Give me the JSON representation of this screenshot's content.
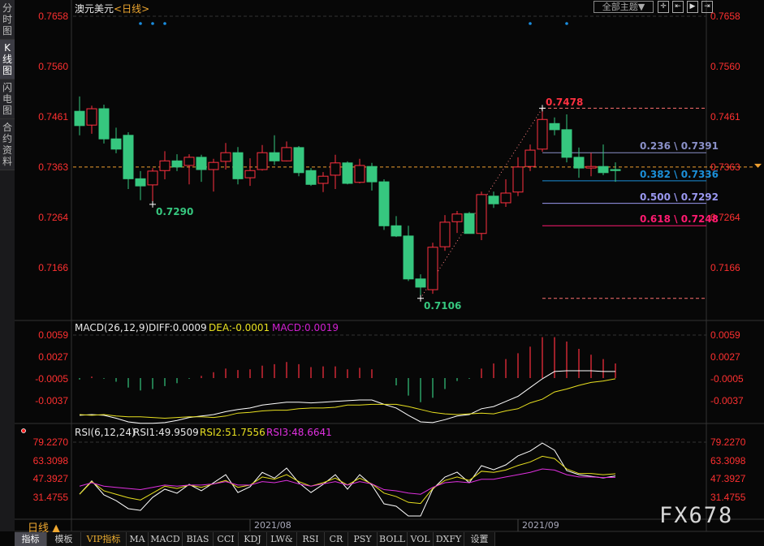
{
  "sidebar": {
    "tabs": [
      {
        "label": "分时图",
        "active": false
      },
      {
        "label": "K线图",
        "active": true
      },
      {
        "label": "闪电图",
        "active": false
      },
      {
        "label": "合约资料",
        "active": false
      }
    ]
  },
  "header": {
    "symbol": "澳元美元",
    "period": "<日线>",
    "themes_button": "全部主题▼",
    "icons": [
      "crosshair-icon",
      "zoom-left-icon",
      "play-forward-icon",
      "move-right-icon"
    ]
  },
  "colors": {
    "up": "#ff3040",
    "down": "#36c77f",
    "axis": "#ff3030",
    "diff": "#ffffff",
    "dea": "#e8e020",
    "macd": "#d020d0",
    "rsi1": "#ffffff",
    "rsi2": "#e8e020",
    "rsi3": "#e030e0",
    "current": "#f0a030"
  },
  "chart_data": [
    {
      "type": "candlestick",
      "title": "澳元美元 日线",
      "y_ticks": [
        "0.7658",
        "0.7560",
        "0.7461",
        "0.7363",
        "0.7264",
        "0.7166"
      ],
      "ylim": [
        0.709,
        0.7658
      ],
      "current_price": "0.7363",
      "x_labels": [
        "2021/08",
        "2021/09"
      ],
      "x_label_index": [
        16,
        38
      ],
      "ohlc": [
        [
          0.7472,
          0.7501,
          0.7425,
          0.7444
        ],
        [
          0.7445,
          0.7483,
          0.7428,
          0.7477
        ],
        [
          0.7477,
          0.7485,
          0.7409,
          0.7418
        ],
        [
          0.7418,
          0.744,
          0.739,
          0.7398
        ],
        [
          0.7425,
          0.7431,
          0.732,
          0.734
        ],
        [
          0.734,
          0.7355,
          0.7298,
          0.7326
        ],
        [
          0.7328,
          0.7361,
          0.729,
          0.7355
        ],
        [
          0.7356,
          0.7394,
          0.7339,
          0.7375
        ],
        [
          0.7375,
          0.7388,
          0.7355,
          0.7363
        ],
        [
          0.7366,
          0.7388,
          0.7329,
          0.7382
        ],
        [
          0.7382,
          0.7387,
          0.7334,
          0.7358
        ],
        [
          0.7358,
          0.7379,
          0.7315,
          0.7372
        ],
        [
          0.7374,
          0.741,
          0.7358,
          0.7391
        ],
        [
          0.7391,
          0.7402,
          0.7329,
          0.734
        ],
        [
          0.7342,
          0.738,
          0.7326,
          0.7356
        ],
        [
          0.7358,
          0.7406,
          0.7356,
          0.7391
        ],
        [
          0.7391,
          0.7425,
          0.7367,
          0.7375
        ],
        [
          0.7375,
          0.7413,
          0.7374,
          0.7401
        ],
        [
          0.7401,
          0.7404,
          0.7345,
          0.7352
        ],
        [
          0.7356,
          0.7361,
          0.7326,
          0.7329
        ],
        [
          0.7331,
          0.7353,
          0.7314,
          0.7345
        ],
        [
          0.7347,
          0.7387,
          0.732,
          0.7371
        ],
        [
          0.7371,
          0.7374,
          0.7329,
          0.7331
        ],
        [
          0.7333,
          0.7379,
          0.7331,
          0.7366
        ],
        [
          0.7364,
          0.7371,
          0.7317,
          0.7334
        ],
        [
          0.7334,
          0.7339,
          0.724,
          0.7248
        ],
        [
          0.7248,
          0.7267,
          0.7226,
          0.7228
        ],
        [
          0.7228,
          0.7248,
          0.714,
          0.7144
        ],
        [
          0.7144,
          0.7153,
          0.7106,
          0.7128
        ],
        [
          0.7123,
          0.7215,
          0.7115,
          0.7206
        ],
        [
          0.7207,
          0.7269,
          0.7199,
          0.7255
        ],
        [
          0.7256,
          0.7277,
          0.7234,
          0.7271
        ],
        [
          0.7272,
          0.7275,
          0.7233,
          0.7233
        ],
        [
          0.7233,
          0.7315,
          0.722,
          0.7309
        ],
        [
          0.7306,
          0.7315,
          0.7283,
          0.7291
        ],
        [
          0.7293,
          0.7339,
          0.7285,
          0.7312
        ],
        [
          0.7314,
          0.7382,
          0.7306,
          0.7363
        ],
        [
          0.7364,
          0.7407,
          0.7355,
          0.7396
        ],
        [
          0.7398,
          0.7478,
          0.7393,
          0.7456
        ],
        [
          0.7448,
          0.746,
          0.7425,
          0.7436
        ],
        [
          0.7436,
          0.7466,
          0.7372,
          0.7382
        ],
        [
          0.7382,
          0.7401,
          0.7342,
          0.7361
        ],
        [
          0.7361,
          0.7391,
          0.7345,
          0.7364
        ],
        [
          0.7364,
          0.7407,
          0.7347,
          0.7352
        ],
        [
          0.7358,
          0.7372,
          0.7334,
          0.7356
        ]
      ],
      "annotations": {
        "low": {
          "index": 28,
          "value": "0.7106"
        },
        "high": {
          "index": 38,
          "value": "0.7478"
        },
        "prior_low": {
          "index": 6,
          "value": "0.7290"
        }
      },
      "fibonacci": [
        {
          "label": "0.236 \\ 0.7391",
          "price": 0.7391,
          "color": "#8a90c8"
        },
        {
          "label": "0.382 \\ 0.7336",
          "price": 0.7336,
          "color": "#1c8fd8"
        },
        {
          "label": "0.500 \\ 0.7292",
          "price": 0.7292,
          "color": "#9a98f0"
        },
        {
          "label": "0.618 \\ 0.7248",
          "price": 0.7248,
          "color": "#ff1a70"
        }
      ],
      "markers_index": [
        5,
        6,
        7,
        37,
        40
      ]
    },
    {
      "type": "bar+line",
      "title": "MACD(26,12,9)",
      "legend": {
        "name": "MACD(26,12,9)",
        "diff": "DIFF:0.0009",
        "dea": "DEA:-0.0001",
        "macd": "MACD:0.0019"
      },
      "y_ticks": [
        "0.0059",
        "0.0027",
        "-0.0005",
        "-0.0037"
      ],
      "diff": [
        -0.0051,
        -0.005,
        -0.0051,
        -0.0055,
        -0.006,
        -0.0062,
        -0.0062,
        -0.0061,
        -0.0058,
        -0.0054,
        -0.0052,
        -0.005,
        -0.0046,
        -0.0043,
        -0.0041,
        -0.0037,
        -0.0035,
        -0.0033,
        -0.0033,
        -0.0034,
        -0.0033,
        -0.0032,
        -0.0031,
        -0.003,
        -0.003,
        -0.0036,
        -0.0041,
        -0.0051,
        -0.006,
        -0.0061,
        -0.0057,
        -0.0052,
        -0.005,
        -0.0042,
        -0.0039,
        -0.0032,
        -0.0025,
        -0.0013,
        -0.0001,
        0.0009,
        0.001,
        0.001,
        0.001,
        0.0009,
        0.0009
      ],
      "dea": [
        -0.005,
        -0.0051,
        -0.005,
        -0.0052,
        -0.0053,
        -0.0053,
        -0.0054,
        -0.0055,
        -0.0054,
        -0.0053,
        -0.0053,
        -0.0054,
        -0.0052,
        -0.0048,
        -0.0047,
        -0.0045,
        -0.0044,
        -0.0044,
        -0.0042,
        -0.0041,
        -0.0041,
        -0.004,
        -0.0037,
        -0.0037,
        -0.0036,
        -0.0036,
        -0.0036,
        -0.0039,
        -0.0043,
        -0.0047,
        -0.0049,
        -0.005,
        -0.0049,
        -0.0048,
        -0.0049,
        -0.0045,
        -0.0042,
        -0.0034,
        -0.0029,
        -0.0019,
        -0.0015,
        -0.001,
        -0.0006,
        -0.0004,
        -0.0001
      ],
      "macd": [
        -0.0002,
        0.0002,
        -0.0001,
        -0.0005,
        -0.0013,
        -0.0017,
        -0.0015,
        -0.0011,
        -0.0007,
        -0.0001,
        0.0003,
        0.0008,
        0.0013,
        0.0011,
        0.0012,
        0.0017,
        0.0019,
        0.0022,
        0.0019,
        0.0015,
        0.0016,
        0.0016,
        0.0012,
        0.0014,
        0.0012,
        0.0,
        -0.001,
        -0.0024,
        -0.0033,
        -0.0027,
        -0.0015,
        -0.0004,
        -0.0001,
        0.0013,
        0.002,
        0.0026,
        0.0034,
        0.0043,
        0.0056,
        0.0056,
        0.005,
        0.004,
        0.0032,
        0.0026,
        0.002
      ]
    },
    {
      "type": "line",
      "title": "RSI(6,12,24)",
      "legend": {
        "name": "RSI(6,12,24)",
        "rsi1": "RSI1:49.9509",
        "rsi2": "RSI2:51.7556",
        "rsi3": "RSI3:48.6641"
      },
      "y_ticks": [
        "79.2270",
        "63.3098",
        "47.3927",
        "31.4755"
      ],
      "rsi1": [
        34.2,
        45.6,
        33.5,
        28.5,
        21.5,
        20.0,
        31.3,
        38.4,
        34.9,
        42.6,
        37.0,
        44.0,
        51.0,
        35.5,
        40.5,
        53.0,
        48.0,
        56.7,
        44.0,
        35.5,
        42.6,
        51.0,
        38.4,
        51.0,
        41.9,
        25.7,
        23.6,
        15.1,
        15.1,
        38.4,
        48.9,
        53.2,
        44.0,
        58.8,
        55.3,
        59.5,
        67.3,
        71.5,
        78.5,
        72.2,
        54.6,
        51.0,
        49.6,
        48.2,
        49.95
      ],
      "rsi2": [
        34,
        45,
        37,
        34,
        31,
        29,
        35,
        41,
        39,
        42,
        40,
        43,
        46,
        40,
        42,
        49,
        47,
        51,
        45,
        41,
        44,
        48,
        42,
        48,
        43,
        35,
        32,
        27,
        26,
        39,
        46,
        49,
        46,
        54,
        53,
        55,
        59,
        62,
        67,
        65,
        56,
        52,
        52,
        51,
        51.76
      ],
      "rsi3": [
        41,
        44,
        41,
        40,
        39,
        38,
        40,
        42,
        41,
        42,
        42,
        43,
        45,
        42,
        42,
        45,
        44,
        46,
        43,
        41,
        43,
        45,
        42,
        45,
        43,
        38,
        37,
        35,
        34,
        40,
        44,
        45,
        44,
        47,
        47,
        49,
        51,
        53,
        56,
        55,
        51,
        49,
        49,
        48.5,
        48.66
      ]
    }
  ],
  "period_selector": "日线 ▲",
  "toolbar": {
    "tabs": [
      "指标",
      "模板",
      "VIP指标",
      "MA",
      "MACD",
      "BIAS",
      "CCI",
      "KDJ",
      "LW&",
      "RSI",
      "CR",
      "PSY",
      "BOLL",
      "VOL",
      "DXFY",
      "设置"
    ]
  },
  "watermark": "FX678"
}
